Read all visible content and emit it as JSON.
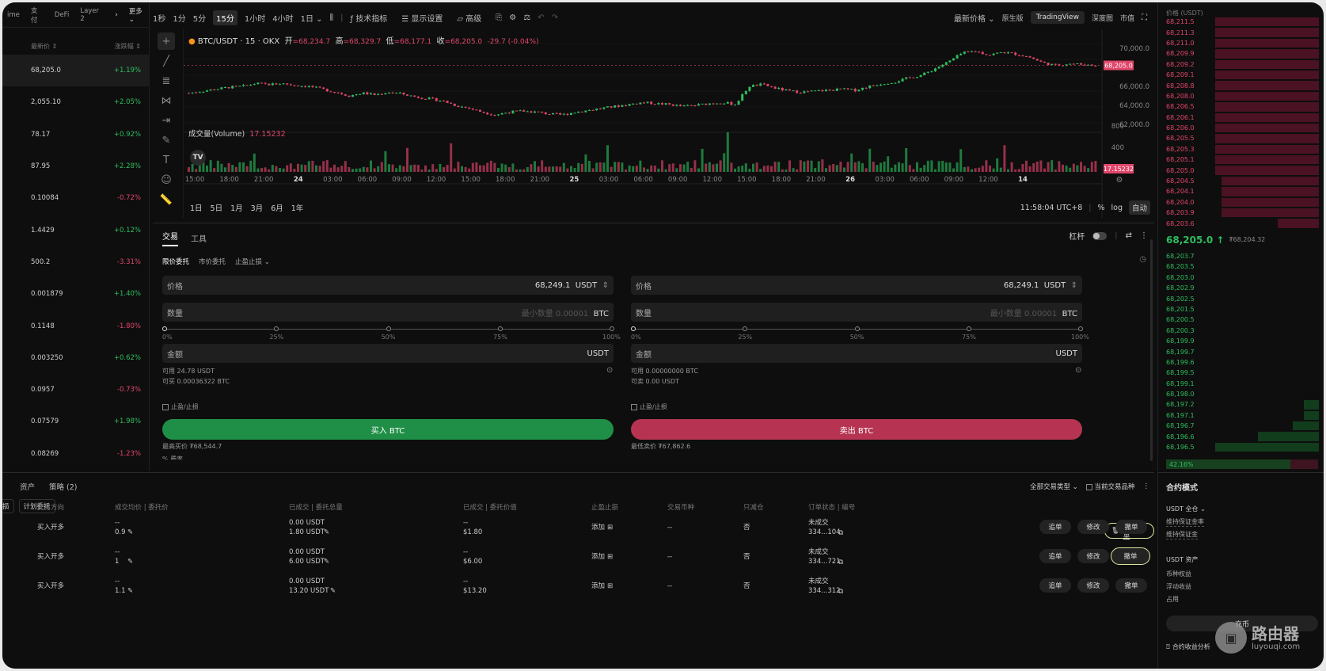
{
  "left": {
    "tabs": [
      "ime",
      "支付",
      "DeFi",
      "Layer 2"
    ],
    "hdr": {
      "price": "最新价 ⇕",
      "change": "涨跌幅 ⇕"
    },
    "rows": [
      {
        "price": "68,205.0",
        "chg": "+1.19%",
        "up": true
      },
      {
        "price": "2,055.10",
        "chg": "+2.05%",
        "up": true
      },
      {
        "price": "78.17",
        "chg": "+0.92%",
        "up": true
      },
      {
        "price": "87.95",
        "chg": "+2.28%",
        "up": true
      },
      {
        "price": "0.10084",
        "chg": "-0.72%",
        "up": false
      },
      {
        "price": "1.4429",
        "chg": "+0.12%",
        "up": true
      },
      {
        "price": "500.2",
        "chg": "-3.31%",
        "up": false
      },
      {
        "price": "0.001879",
        "chg": "+1.40%",
        "up": true
      },
      {
        "price": "0.1148",
        "chg": "-1.80%",
        "up": false
      },
      {
        "price": "0.003250",
        "chg": "+0.62%",
        "up": true
      },
      {
        "price": "0.0957",
        "chg": "-0.73%",
        "up": false
      },
      {
        "price": "0.07579",
        "chg": "+1.98%",
        "up": true
      },
      {
        "price": "0.08269",
        "chg": "-1.23%",
        "up": false
      }
    ]
  },
  "topbar": {
    "more": "更多 ⌄",
    "intervals": [
      "1秒",
      "1分",
      "5分",
      "15分",
      "1小时",
      "4小时",
      "1日 ⌄"
    ],
    "active": "15分",
    "indicators": "技术指标",
    "display": "显示设置",
    "advanced": "高级",
    "price_type": "最新价格 ⌄",
    "views": [
      "原生版",
      "TradingView",
      "深度图",
      "市值"
    ],
    "active_view": "TradingView"
  },
  "chart": {
    "symbol": "BTC/USDT · 15 · OKX",
    "o_lbl": "开",
    "o": "=68,234.7",
    "h_lbl": "高",
    "h": "=68,329.7",
    "l_lbl": "低",
    "l": "=68,177.1",
    "c_lbl": "收",
    "c": "=68,205.0",
    "chg": "-29.7 (-0.04%)",
    "vol_lbl": "成交量(Volume)",
    "vol": "17.15232",
    "price_ticks": [
      "70,000.0",
      "66,000.0",
      "64,000.0",
      "62,000.0"
    ],
    "price_ticks_y": [
      70000,
      66000,
      64000,
      62000
    ],
    "cur_price": "68,205.0",
    "vol_ticks": [
      "800",
      "400"
    ],
    "vol_cur": "17.15232",
    "x_ticks": [
      "15:00",
      "18:00",
      "21:00",
      "24",
      "03:00",
      "06:00",
      "09:00",
      "12:00",
      "15:00",
      "18:00",
      "21:00",
      "25",
      "03:00",
      "06:00",
      "09:00",
      "12:00",
      "15:00",
      "18:00",
      "21:00",
      "26",
      "03:00",
      "06:00",
      "09:00",
      "12:00",
      "14"
    ],
    "ranges": [
      "1日",
      "5日",
      "1月",
      "3月",
      "6月",
      "1年"
    ],
    "time": "11:58:04 UTC+8",
    "pct": "%",
    "log": "log",
    "auto": "自动"
  },
  "chart_data": {
    "type": "candlestick",
    "ylim": [
      62000,
      70500
    ],
    "close_path": [
      65300,
      65500,
      65700,
      65900,
      66000,
      66300,
      66200,
      66300,
      66100,
      66000,
      65700,
      65400,
      65000,
      65300,
      65100,
      65400,
      65200,
      64900,
      64700,
      64500,
      64000,
      63700,
      63300,
      63000,
      63300,
      63400,
      63300,
      63100,
      63000,
      63300,
      63500,
      63700,
      63900,
      64100,
      64300,
      64200,
      64100,
      63900,
      64000,
      64200,
      64300,
      64100,
      66000,
      66200,
      65800,
      65500,
      65400,
      65500,
      65600,
      65700,
      65600,
      66000,
      66300,
      66500,
      66900,
      67200,
      67900,
      68600,
      69500,
      69700,
      69300,
      69600,
      69400,
      69100,
      68500,
      68200,
      68400,
      68300,
      68200
    ]
  },
  "trade": {
    "tabs": [
      "交易",
      "工具"
    ],
    "leverage": "杠杆",
    "order_types": [
      "限价委托",
      "市价委托",
      "止盈止损 ⌄"
    ],
    "buy": {
      "price_lbl": "价格",
      "price": "68,249.1",
      "unit": "USDT",
      "qty_lbl": "数量",
      "qty_ph": "最小数量 0.00001",
      "qty_unit": "BTC",
      "amt_lbl": "金额",
      "amt_unit": "USDT",
      "avail": "可用 24.78 USDT",
      "can": "可买 0.00036322 BTC",
      "tpsl": "止盈/止损",
      "btn": "买入 BTC",
      "max": "最高买价 ₮68,544.7",
      "fee": "% 费率"
    },
    "sell": {
      "price_lbl": "价格",
      "price": "68,249.1",
      "unit": "USDT",
      "qty_lbl": "数量",
      "qty_ph": "最小数量 0.00001",
      "qty_unit": "BTC",
      "amt_lbl": "金额",
      "amt_unit": "USDT",
      "avail": "可用 0.00000000 BTC",
      "can": "可卖 0.00 USDT",
      "tpsl": "止盈/止损",
      "btn": "卖出 BTC",
      "min": "最低卖价 ₮67,862.6"
    },
    "pcts": [
      "0%",
      "25%",
      "50%",
      "75%",
      "100%"
    ]
  },
  "book": {
    "hdr": "价格 (USDT)",
    "asks": [
      "68,211.5",
      "68,211.3",
      "68,211.0",
      "68,209.9",
      "68,209.2",
      "68,209.1",
      "68,208.8",
      "68,208.0",
      "68,206.5",
      "68,206.1",
      "68,206.0",
      "68,205.5",
      "68,205.3",
      "68,205.1",
      "68,205.0",
      "68,204.5",
      "68,204.1",
      "68,204.0",
      "68,203.9",
      "68,203.6"
    ],
    "ask_depth": [
      0.68,
      0.68,
      0.68,
      0.68,
      0.68,
      0.68,
      0.68,
      0.68,
      0.68,
      0.68,
      0.68,
      0.68,
      0.68,
      0.68,
      0.68,
      0.64,
      0.64,
      0.64,
      0.64,
      0.27
    ],
    "mid": "68,205.0 ↑",
    "mid_sub": "₮68,204.32",
    "bids": [
      "68,203.7",
      "68,203.5",
      "68,203.0",
      "68,202.9",
      "68,202.5",
      "68,201.5",
      "68,200.5",
      "68,200.3",
      "68,199.9",
      "68,199.7",
      "68,199.6",
      "68,199.5",
      "68,199.1",
      "68,198.0",
      "68,197.2",
      "68,197.1",
      "68,196.7",
      "68,196.6",
      "68,196.5"
    ],
    "bid_depth": [
      0,
      0,
      0,
      0,
      0,
      0,
      0,
      0,
      0,
      0,
      0,
      0,
      0,
      0,
      0.1,
      0.1,
      0.17,
      0.4,
      0.68
    ],
    "ratio": "42.16%"
  },
  "bottom": {
    "tabs": [
      "资产",
      "策略 (2)"
    ],
    "filters": [
      "全部交易类型 ⌄",
      "当前交易品种"
    ],
    "subtabs": [
      "损",
      "计划委托"
    ],
    "cols": [
      "交易方向",
      "成交均价 | 委托价",
      "已成交 | 委托总量",
      "已成交 | 委托价值",
      "止盈止损",
      "交易币种",
      "只减仓",
      "订单状态 | 编号"
    ],
    "batch": "批量撤单",
    "rows": [
      {
        "side": "买入开多",
        "price1": "--",
        "price2": "0.9",
        "filled1": "0.00 USDT",
        "filled2": "1.80 USDT",
        "val1": "--",
        "val2": "$1.80",
        "tp": "添加",
        "coin": "--",
        "reduce": "否",
        "status": "未成交",
        "id": "334...104"
      },
      {
        "side": "买入开多",
        "price1": "--",
        "price2": "1",
        "filled1": "0.00 USDT",
        "filled2": "6.00 USDT",
        "val1": "--",
        "val2": "$6.00",
        "tp": "添加",
        "coin": "--",
        "reduce": "否",
        "status": "未成交",
        "id": "334...721"
      },
      {
        "side": "买入开多",
        "price1": "--",
        "price2": "1.1",
        "filled1": "0.00 USDT",
        "filled2": "13.20 USDT",
        "val1": "--",
        "val2": "$13.20",
        "tp": "添加",
        "coin": "--",
        "reduce": "否",
        "status": "未成交",
        "id": "334...312"
      }
    ],
    "actions": [
      "追单",
      "修改",
      "撤单"
    ]
  },
  "contract": {
    "title": "合约模式",
    "mode": "USDT 全仓 ⌄",
    "l1": "维持保证金率",
    "l2": "维持保证金",
    "assets": "USDT 资产",
    "a1": "币种权益",
    "a2": "浮动收益",
    "a3": "占用",
    "btn": "充币",
    "analysis": "合约收益分析"
  },
  "watermark": {
    "name": "路由器",
    "url": "luyouqi.com"
  }
}
